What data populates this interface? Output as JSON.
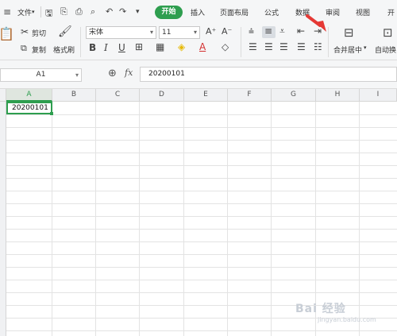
{
  "menu": {
    "file_label": "文件",
    "tabs": [
      "开始",
      "插入",
      "页面布局",
      "公式",
      "数据",
      "审阅",
      "视图",
      "开"
    ]
  },
  "ribbon": {
    "cut_label": "剪切",
    "copy_label": "复制",
    "format_painter_label": "格式刷",
    "font_name": "宋体",
    "font_size": "11",
    "merge_center_label": "合并居中",
    "auto_wrap_label": "自动换"
  },
  "formula_bar": {
    "name_box": "A1",
    "fx_label": "fx",
    "content": "20200101"
  },
  "columns": [
    "A",
    "B",
    "C",
    "D",
    "E",
    "F",
    "G",
    "H",
    "I"
  ],
  "cells": {
    "A1": "20200101"
  },
  "watermark": {
    "text": "Bai 经验",
    "url": "jingyan.baidu.com"
  },
  "colors": {
    "accent_green": "#2e9e4f",
    "arrow_red": "#e53935"
  }
}
